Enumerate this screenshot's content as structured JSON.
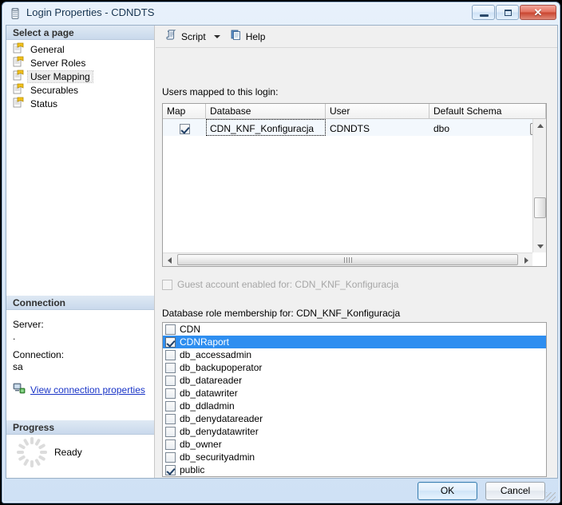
{
  "window": {
    "title": "Login Properties - CDNDTS",
    "icon": "database-icon",
    "minimize_label": "Minimize",
    "maximize_label": "Maximize",
    "close_label": "✕"
  },
  "sidebar": {
    "select_page_header": "Select a page",
    "items": [
      {
        "label": "General",
        "icon": "page-icon",
        "selected": false
      },
      {
        "label": "Server Roles",
        "icon": "page-icon",
        "selected": false
      },
      {
        "label": "User Mapping",
        "icon": "page-icon",
        "selected": true
      },
      {
        "label": "Securables",
        "icon": "page-icon",
        "selected": false
      },
      {
        "label": "Status",
        "icon": "page-icon",
        "selected": false
      }
    ],
    "connection": {
      "header": "Connection",
      "server_label": "Server:",
      "server_value": ".",
      "connection_label": "Connection:",
      "connection_value": "sa",
      "link_text": "View connection properties",
      "link_icon": "server-connection-icon"
    },
    "progress": {
      "header": "Progress",
      "status": "Ready",
      "icon": "spinner-icon"
    }
  },
  "toolbar": {
    "script_label": "Script",
    "script_icon": "script-scroll-icon",
    "dropdown_icon": "chevron-down-icon",
    "help_label": "Help",
    "help_icon": "help-document-icon"
  },
  "main": {
    "users_mapped_label": "Users mapped to this login:",
    "grid": {
      "columns": [
        "Map",
        "Database",
        "User",
        "Default Schema"
      ],
      "rows": [
        {
          "map_checked": true,
          "database": "CDN_KNF_Konfiguracja",
          "user": "CDNDTS",
          "default_schema": "dbo",
          "browse_label": "...",
          "selected": true,
          "focused_cell": "database"
        }
      ]
    },
    "guest_account": {
      "label": "Guest account enabled for: CDN_KNF_Konfiguracja",
      "checked": false,
      "enabled": false
    },
    "role_membership_label": "Database role membership for: CDN_KNF_Konfiguracja",
    "roles": [
      {
        "name": "CDN",
        "checked": false,
        "selected": false
      },
      {
        "name": "CDNRaport",
        "checked": true,
        "selected": true
      },
      {
        "name": "db_accessadmin",
        "checked": false,
        "selected": false
      },
      {
        "name": "db_backupoperator",
        "checked": false,
        "selected": false
      },
      {
        "name": "db_datareader",
        "checked": false,
        "selected": false
      },
      {
        "name": "db_datawriter",
        "checked": false,
        "selected": false
      },
      {
        "name": "db_ddladmin",
        "checked": false,
        "selected": false
      },
      {
        "name": "db_denydatareader",
        "checked": false,
        "selected": false
      },
      {
        "name": "db_denydatawriter",
        "checked": false,
        "selected": false
      },
      {
        "name": "db_owner",
        "checked": false,
        "selected": false
      },
      {
        "name": "db_securityadmin",
        "checked": false,
        "selected": false
      },
      {
        "name": "public",
        "checked": true,
        "selected": false
      }
    ]
  },
  "footer": {
    "ok_label": "OK",
    "cancel_label": "Cancel"
  },
  "colors": {
    "selection_blue": "#2e8ef0",
    "link_blue": "#1934c7",
    "title_text": "#12314f",
    "close_red": "#c9432f"
  }
}
